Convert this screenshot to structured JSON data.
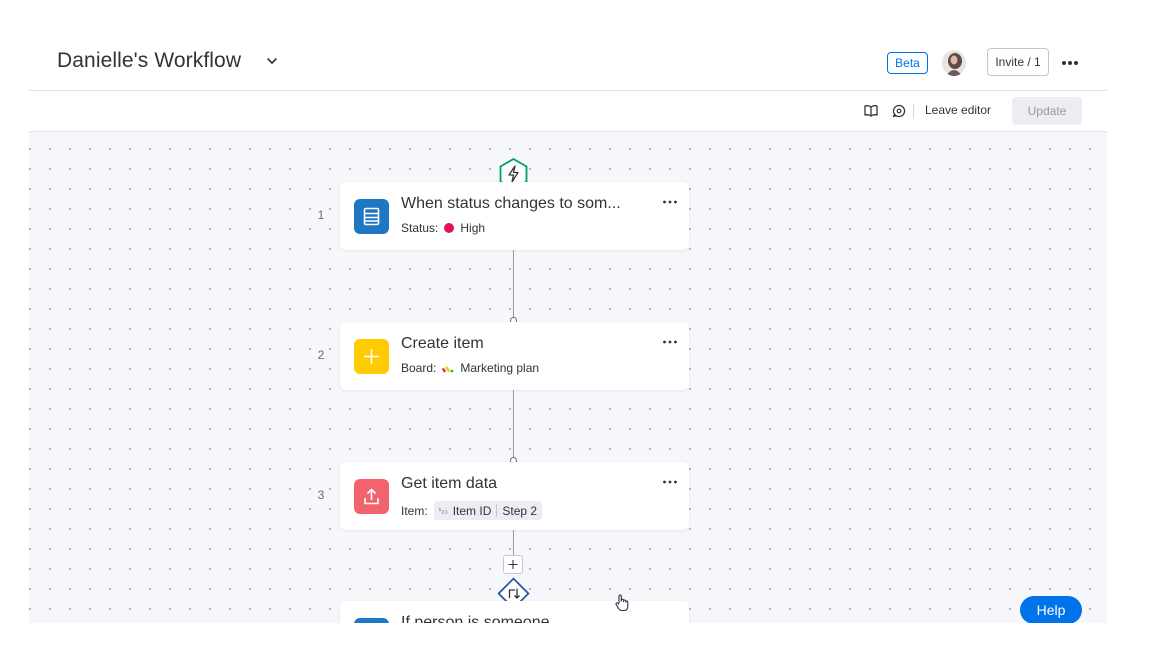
{
  "header": {
    "title": "Danielle's Workflow",
    "badge": "Beta",
    "invite_label": "Invite / 1"
  },
  "toolbar": {
    "leave_editor_label": "Leave editor",
    "update_label": "Update"
  },
  "steps": [
    {
      "number": "1",
      "title": "When status changes to som...",
      "field_label": "Status:",
      "value": "High",
      "icon": "table-icon",
      "icon_color": "#1f76c2"
    },
    {
      "number": "2",
      "title": "Create item",
      "field_label": "Board:",
      "value": "Marketing plan",
      "icon": "plus-icon",
      "icon_color": "#ffcb00"
    },
    {
      "number": "3",
      "title": "Get item data",
      "field_label": "Item:",
      "chip_prefix": "¹₂₃",
      "chip_value": "Item ID",
      "chip_step": "Step 2",
      "icon": "upload-icon",
      "icon_color": "#e2445c"
    },
    {
      "title": "If person is someone",
      "icon": "table-icon",
      "icon_color": "#1f76c2"
    }
  ],
  "help_label": "Help",
  "colors": {
    "primary": "#0073ea",
    "status_high": "#e2115e",
    "trigger_green": "#00a359",
    "condition_blue": "#2b5797"
  }
}
